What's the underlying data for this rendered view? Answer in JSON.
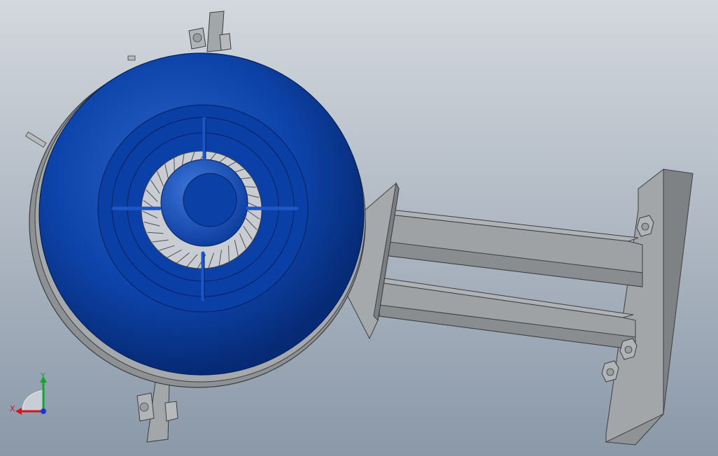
{
  "viewport": {
    "background_top": "#cfd5dc",
    "background_bottom": "#8e9cab"
  },
  "model": {
    "body_color": "#0a3fa6",
    "body_highlight": "#3d74d6",
    "body_shadow": "#072b7a",
    "frame_color": "#9a9d9f",
    "frame_dark": "#5f6366",
    "blade_color": "#d4d8dc"
  },
  "triad": {
    "x_label": "X",
    "y_label": "Y",
    "x_color": "#d0161a",
    "y_color": "#16a23a",
    "z_color": "#2433d6"
  }
}
